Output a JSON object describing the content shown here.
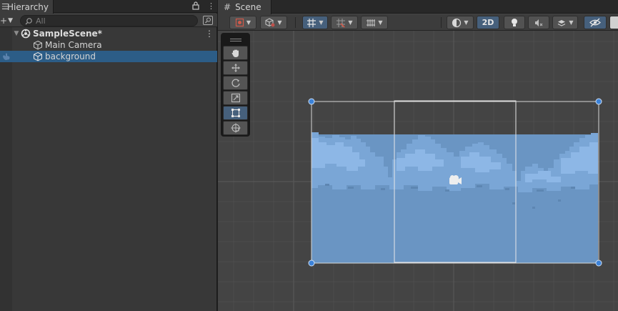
{
  "hierarchy": {
    "tab_title": "Hierarchy",
    "search": {
      "placeholder": "All",
      "value": ""
    },
    "scene": {
      "name": "SampleScene*"
    },
    "objects": [
      {
        "name": "Main Camera",
        "selected": false
      },
      {
        "name": "background",
        "selected": true
      }
    ]
  },
  "scene_view": {
    "tab_title": "Scene",
    "toolbar": {
      "mode_2d_label": "2D"
    },
    "tools": [
      "hand-tool",
      "move-tool",
      "rotate-tool",
      "scale-tool",
      "rect-tool",
      "transform-tool"
    ],
    "active_tool": "rect-tool"
  },
  "colors": {
    "selection": "#2c5d87",
    "active_button": "#46607c",
    "sky_sprite": "#6a95c3",
    "cloud_light": "#8db7e6",
    "cloud_mid": "#7aa6d6",
    "gizmo_handle": "#3b82d9"
  }
}
